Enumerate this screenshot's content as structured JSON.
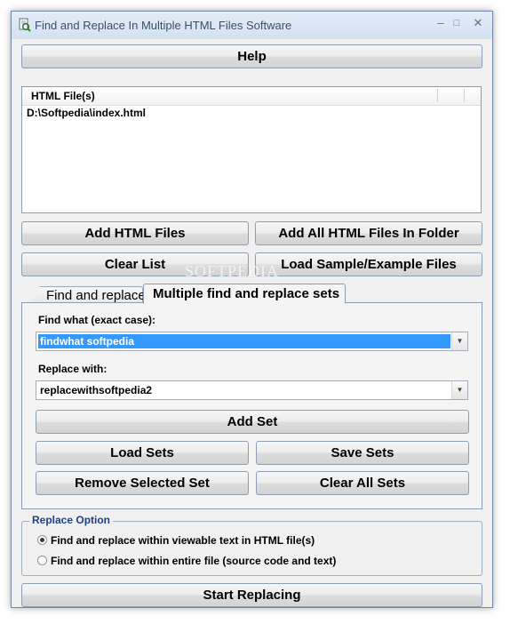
{
  "window": {
    "title": "Find and Replace In Multiple HTML Files Software",
    "controls": {
      "minimize": "–",
      "maximize": "□",
      "close": "✕"
    }
  },
  "help_button": "Help",
  "files_list": {
    "column_header": "HTML File(s)",
    "items": [
      "D:\\Softpedia\\index.html"
    ]
  },
  "file_buttons": {
    "add_html_files": "Add HTML Files",
    "add_all_html_files_in_folder": "Add All HTML Files In Folder",
    "clear_list": "Clear List",
    "load_sample_files": "Load Sample/Example Files"
  },
  "watermark": "SOFTPEDIA",
  "tabs": [
    {
      "label": "Find and replace",
      "active": false
    },
    {
      "label": "Multiple find and replace sets",
      "active": true
    }
  ],
  "sets_panel": {
    "find_label": "Find what (exact case):",
    "find_value": "findwhat softpedia",
    "replace_label": "Replace with:",
    "replace_value": "replacewithsoftpedia2",
    "add_set": "Add Set",
    "load_sets": "Load Sets",
    "save_sets": "Save Sets",
    "remove_selected_set": "Remove Selected Set",
    "clear_all_sets": "Clear All Sets"
  },
  "replace_option": {
    "title": "Replace Option",
    "options": [
      {
        "label": "Find and replace within viewable text in HTML file(s)",
        "selected": true
      },
      {
        "label": "Find and replace within entire file (source code and text)",
        "selected": false
      }
    ]
  },
  "start_button": "Start Replacing",
  "colors": {
    "selection_highlight": "#3399ff",
    "group_title": "#1e3f8a",
    "window_frame": "#dfe9f5"
  }
}
